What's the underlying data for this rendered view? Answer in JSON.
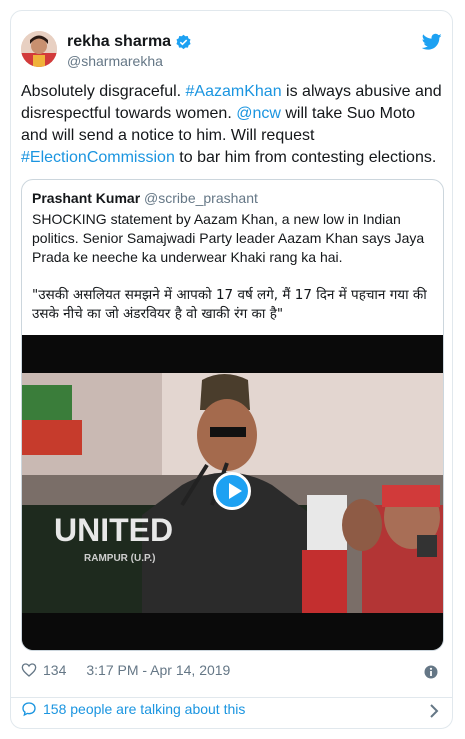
{
  "author": {
    "name": "rekha sharma",
    "handle": "@sharmarekha"
  },
  "tweet": {
    "parts": [
      {
        "text": "Absolutely disgraceful. ",
        "link": false
      },
      {
        "text": "#AazamKhan",
        "link": true
      },
      {
        "text": " is always abusive and disrespectful towards women. ",
        "link": false
      },
      {
        "text": "@ncw",
        "link": true
      },
      {
        "text": " will take Suo Moto and will send a notice to him. Will request ",
        "link": false
      },
      {
        "text": "#ElectionCommission",
        "link": true
      },
      {
        "text": " to bar him from contesting elections.",
        "link": false
      }
    ]
  },
  "quoted": {
    "name": "Prashant Kumar",
    "handle": "@scribe_prashant",
    "text": "SHOCKING statement by Aazam Khan, a new low in Indian politics. Senior Samajwadi Party leader Aazam Khan says Jaya Prada ke neeche ka underwear Khaki rang ka hai.",
    "hindi": "\"उसकी असलियत समझने में आपको 17 वर्ष लगे, मैं 17 दिन में पहचान गया की उसके नीचे का जो अंडरवियर है वो खाकी रंग का है\"",
    "video_text": {
      "united": "UNITED",
      "rampur": "RAMPUR (U.P.)"
    }
  },
  "meta": {
    "likes": "134",
    "timestamp": "3:17 PM - Apr 14, 2019"
  },
  "footer": {
    "talking": "158 people are talking about this"
  },
  "colors": {
    "link": "#1b95e0",
    "twitter_blue": "#1da1f2",
    "muted": "#657786"
  }
}
